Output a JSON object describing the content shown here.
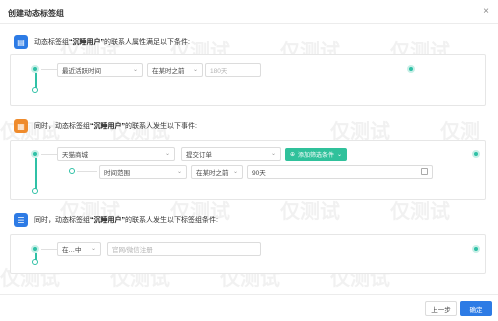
{
  "dialog": {
    "title": "创建动态标签组",
    "close_icon": "×"
  },
  "section1": {
    "prefix": "动态标签组",
    "tag": "“沉睡用户”",
    "suffix": "的联系人属性满足以下条件:",
    "field": "最近活跃时间",
    "operator": "在某时之前",
    "value": "180天"
  },
  "section2": {
    "prefix": "同时，动态标签组",
    "tag": "“沉睡用户”",
    "suffix": "的联系人发生以下事件:",
    "platform": "天猫商城",
    "event": "提交订单",
    "add_filter": "添加筛选条件",
    "range_label": "时间范围",
    "range_operator": "在某时之前",
    "range_value": "90天"
  },
  "section3": {
    "prefix": "同时，动态标签组",
    "tag": "“沉睡用户”",
    "suffix": "的联系人发生以下标签组条件:",
    "condition": "在…中",
    "placeholder": "官网/微信注册"
  },
  "footer": {
    "prev": "上一步",
    "ok": "确定"
  },
  "watermark": "仅测试"
}
